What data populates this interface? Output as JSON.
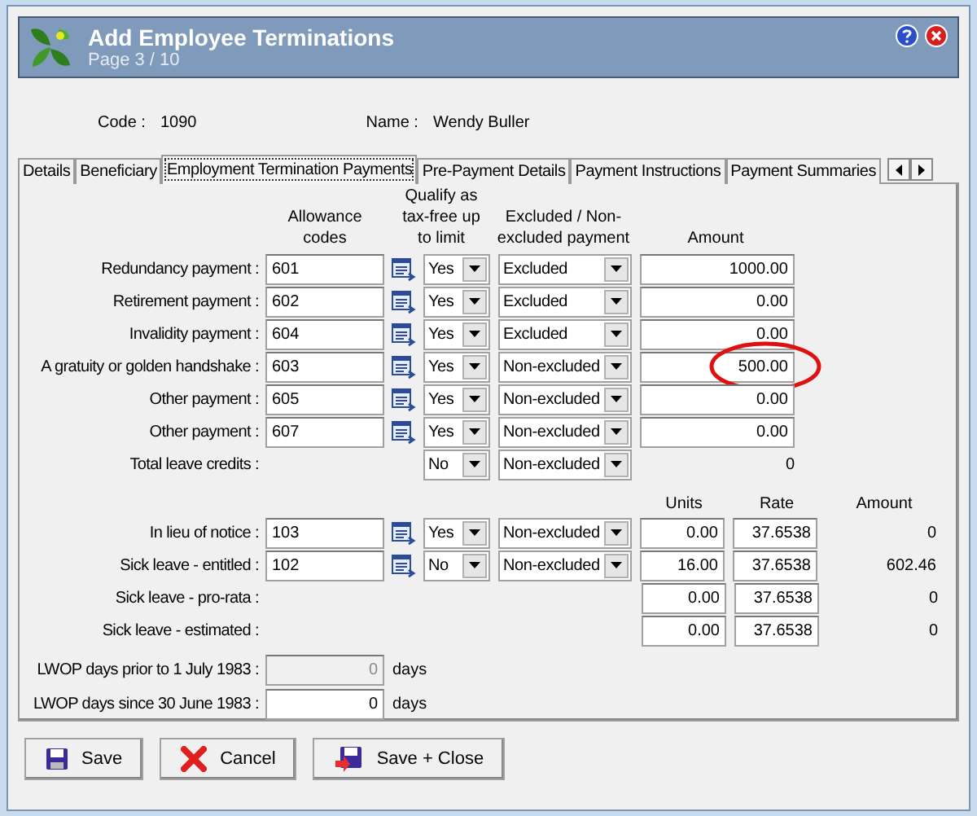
{
  "window": {
    "title": "Add Employee Terminations",
    "subtitle": "Page 3 / 10"
  },
  "header": {
    "code_label": "Code :",
    "code": "1090",
    "name_label": "Name :",
    "name": "Wendy Buller"
  },
  "tabs": [
    {
      "label": "Details",
      "selected": false
    },
    {
      "label": "Beneficiary",
      "selected": false
    },
    {
      "label": "Employment Termination Payments",
      "selected": true
    },
    {
      "label": "Pre-Payment Details",
      "selected": false
    },
    {
      "label": "Payment Instructions",
      "selected": false
    },
    {
      "label": "Payment Summaries",
      "selected": false
    }
  ],
  "payments": {
    "headings": [
      "Allowance codes",
      "Qualify as tax-free up to limit",
      "Excluded / Non-excluded payment",
      "Amount"
    ],
    "rows": [
      {
        "kind": "input",
        "label": "Redundancy payment :",
        "code": "601",
        "tax_free": "Yes",
        "excluded": "Excluded",
        "amount": "1000.00",
        "circled": false
      },
      {
        "kind": "input",
        "label": "Retirement payment :",
        "code": "602",
        "tax_free": "Yes",
        "excluded": "Excluded",
        "amount": "0.00",
        "circled": false
      },
      {
        "kind": "input",
        "label": "Invalidity payment :",
        "code": "604",
        "tax_free": "Yes",
        "excluded": "Excluded",
        "amount": "0.00",
        "circled": false
      },
      {
        "kind": "input",
        "label": "A gratuity or golden handshake :",
        "code": "603",
        "tax_free": "Yes",
        "excluded": "Non-excluded",
        "amount": "500.00",
        "circled": true
      },
      {
        "kind": "input",
        "label": "Other payment :",
        "code": "605",
        "tax_free": "Yes",
        "excluded": "Non-excluded",
        "amount": "0.00",
        "circled": false
      },
      {
        "kind": "input",
        "label": "Other payment :",
        "code": "607",
        "tax_free": "Yes",
        "excluded": "Non-excluded",
        "amount": "0.00",
        "circled": false
      },
      {
        "kind": "total",
        "label": "Total leave credits :",
        "tax_free": "No",
        "excluded": "Non-excluded",
        "amount": "0"
      }
    ]
  },
  "leave": {
    "headings": [
      "Units",
      "Rate",
      "Amount"
    ],
    "rows": [
      {
        "kind": "coded",
        "label": "In lieu of notice :",
        "code": "103",
        "tax_free": "Yes",
        "excluded": "Non-excluded",
        "units": "0.00",
        "rate": "37.6538",
        "amount": "0"
      },
      {
        "kind": "coded",
        "label": "Sick leave - entitled :",
        "code": "102",
        "tax_free": "No",
        "excluded": "Non-excluded",
        "units": "16.00",
        "rate": "37.6538",
        "amount": "602.46"
      },
      {
        "kind": "plain",
        "label": "Sick leave - pro-rata :",
        "units": "0.00",
        "rate": "37.6538",
        "amount": "0"
      },
      {
        "kind": "plain",
        "label": "Sick leave - estimated :",
        "units": "0.00",
        "rate": "37.6538",
        "amount": "0"
      }
    ]
  },
  "lwop": [
    {
      "label": "LWOP days prior to 1 July 1983 :",
      "value": "0",
      "unit": "days",
      "disabled": true
    },
    {
      "label": "LWOP days since 30 June 1983 :",
      "value": "0",
      "unit": "days",
      "disabled": false
    }
  ],
  "buttons": [
    {
      "kind": "save",
      "label": "Save"
    },
    {
      "kind": "cancel",
      "label": "Cancel"
    },
    {
      "kind": "save_close",
      "label": "Save + Close"
    }
  ]
}
